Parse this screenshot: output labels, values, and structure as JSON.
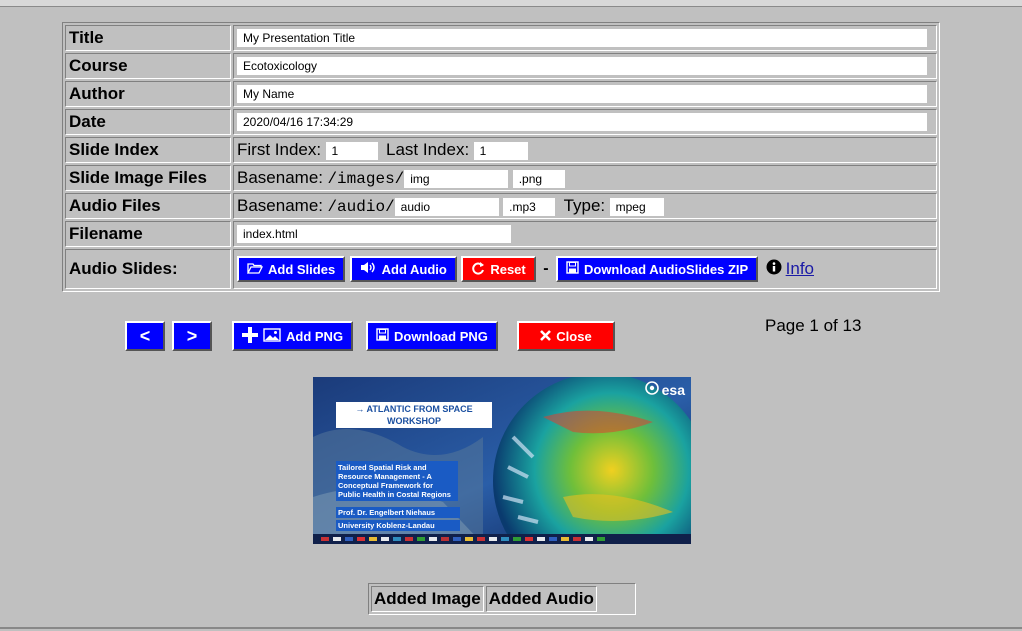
{
  "form": {
    "title_label": "Title",
    "title_value": "My Presentation Title",
    "course_label": "Course",
    "course_value": "Ecotoxicology",
    "author_label": "Author",
    "author_value": "My Name",
    "date_label": "Date",
    "date_value": "2020/04/16 17:34:29",
    "slide_index_label": "Slide Index",
    "first_index_label": "First Index:",
    "first_index_value": "1",
    "last_index_label": "Last Index:",
    "last_index_value": "1",
    "slide_image_files_label": "Slide Image Files",
    "image_basename_label": "Basename:",
    "image_basepath": "/images/",
    "image_basename_value": "img",
    "image_ext_value": ".png",
    "audio_files_label": "Audio Files",
    "audio_basename_label": "Basename:",
    "audio_basepath": "/audio/",
    "audio_basename_value": "audio",
    "audio_ext_value": ".mp3",
    "audio_type_label": "Type:",
    "audio_type_value": "mpeg",
    "filename_label": "Filename",
    "filename_value": "index.html",
    "audio_slides_label": "Audio Slides:"
  },
  "actions": {
    "add_slides": "Add Slides",
    "add_audio": "Add Audio",
    "reset": "Reset",
    "separator": "-",
    "download_zip": "Download AudioSlides ZIP",
    "info": "Info"
  },
  "toolbar": {
    "prev": "<",
    "next": ">",
    "add_png": "Add PNG",
    "download_png": "Download PNG",
    "close": "Close",
    "page_info": "Page 1 of 13"
  },
  "slide": {
    "logo": "esa",
    "event_line1": "→ ATLANTIC FROM SPACE",
    "event_line2": "WORKSHOP",
    "talk_title": "Tailored Spatial Risk and Resource Management - A Conceptual Framework for Public Health in Costal Regions",
    "speaker": "Prof. Dr. Engelbert Niehaus",
    "affiliation": "University Koblenz-Landau"
  },
  "results": {
    "added_image": "Added Image",
    "added_audio": "Added Audio"
  },
  "colors": {
    "button_blue": "#0000ff",
    "button_red": "#ff0000",
    "background": "#c0c0c0"
  }
}
